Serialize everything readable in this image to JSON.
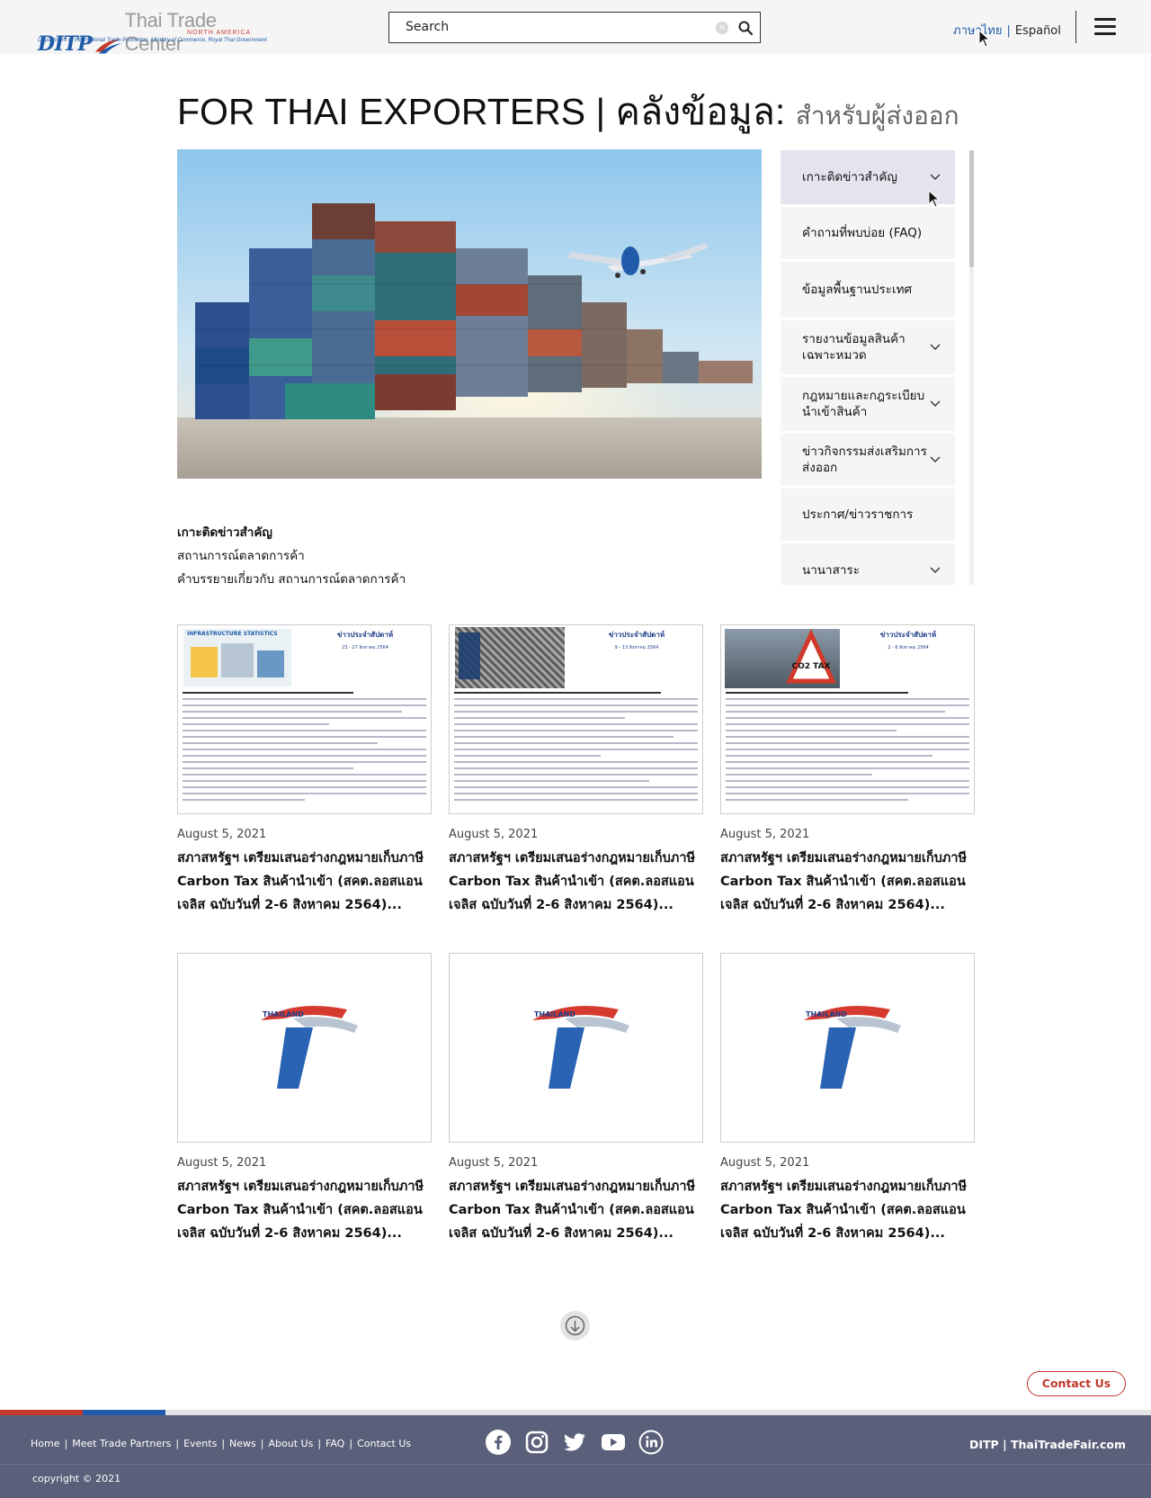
{
  "header": {
    "logo": {
      "brand": "DITP",
      "name": "Thai Trade Center",
      "region": "NORTH AMERICA",
      "tagline": "Department of International Trade Promotion, Ministry of Commerce, Royal Thai Government"
    },
    "search": {
      "placeholder": "Search",
      "value": "Search"
    },
    "language": {
      "thai": "ภาษาไทย",
      "separator": "|",
      "spanish": "Español"
    }
  },
  "page": {
    "title": "FOR THAI EXPORTERS | คลังข้อมูล:",
    "subtitle": "สำหรับผู้ส่งออก"
  },
  "sidebar": {
    "items": [
      {
        "label": "เกาะติดข่าวสำคัญ",
        "expandable": true,
        "active": true
      },
      {
        "label": "คำถามที่พบบ่อย (FAQ)",
        "expandable": false,
        "active": false
      },
      {
        "label": "ข้อมูลพื้นฐานประเทศ",
        "expandable": false,
        "active": false
      },
      {
        "label": "รายงานข้อมูลสินค้าเฉพาะหมวด",
        "expandable": true,
        "active": false
      },
      {
        "label": "กฎหมายและกฎระเบียบนำเข้าสินค้า",
        "expandable": true,
        "active": false
      },
      {
        "label": "ข่าวกิจกรรมส่งเสริมการส่งออก",
        "expandable": true,
        "active": false
      },
      {
        "label": "ประกาศ/ข่าวราชการ",
        "expandable": false,
        "active": false
      },
      {
        "label": "นานาสาระ",
        "expandable": true,
        "active": false
      }
    ]
  },
  "section": {
    "heading": "เกาะติดข่าวสำคัญ",
    "category": "สถานการณ์ตลาดการค้า",
    "description": "คำบรรยายเกี่ยวกับ สถานการณ์ตลาดการค้า"
  },
  "cards": [
    {
      "date": "August 5, 2021",
      "title": "สภาสหรัฐฯ เตรียมเสนอร่างกฎหมายเก็บภาษี Carbon Tax สินค้านำเข้า (สคต.ลอสแอนเจลิส ฉบับวันที่ 2-6 สิงหาคม 2564)...",
      "image": "newsletter-infrastructure",
      "doc_title": "ข่าวประจำสัปดาห์",
      "doc_dates": "23 - 27 สิงหาคม 2564",
      "doc_badge": "INFRASTRUCTURE STATISTICS"
    },
    {
      "date": "August 5, 2021",
      "title": "สภาสหรัฐฯ เตรียมเสนอร่างกฎหมายเก็บภาษี Carbon Tax สินค้านำเข้า (สคต.ลอสแอนเจลิส ฉบับวันที่ 2-6 สิงหาคม 2564)...",
      "image": "newsletter-seafood",
      "doc_title": "ข่าวประจำสัปดาห์",
      "doc_dates": "9 - 13 สิงหาคม 2564",
      "doc_badge": ""
    },
    {
      "date": "August 5, 2021",
      "title": "สภาสหรัฐฯ เตรียมเสนอร่างกฎหมายเก็บภาษี Carbon Tax สินค้านำเข้า (สคต.ลอสแอนเจลิส ฉบับวันที่ 2-6 สิงหาคม 2564)...",
      "image": "newsletter-carbon-tax",
      "doc_title": "ข่าวประจำสัปดาห์",
      "doc_dates": "2 - 6 สิงหาคม 2564",
      "doc_badge": "CO2 TAX"
    },
    {
      "date": "August 5, 2021",
      "title": "สภาสหรัฐฯ เตรียมเสนอร่างกฎหมายเก็บภาษี Carbon Tax สินค้านำเข้า (สคต.ลอสแอนเจลิส ฉบับวันที่ 2-6 สิงหาคม 2564)...",
      "image": "thailand-trust-logo",
      "logo_text": "THAILAND"
    },
    {
      "date": "August 5, 2021",
      "title": "สภาสหรัฐฯ เตรียมเสนอร่างกฎหมายเก็บภาษี Carbon Tax สินค้านำเข้า (สคต.ลอสแอนเจลิส ฉบับวันที่ 2-6 สิงหาคม 2564)...",
      "image": "thailand-trust-logo",
      "logo_text": "THAILAND"
    },
    {
      "date": "August 5, 2021",
      "title": "สภาสหรัฐฯ เตรียมเสนอร่างกฎหมายเก็บภาษี Carbon Tax สินค้านำเข้า (สคต.ลอสแอนเจลิส ฉบับวันที่ 2-6 สิงหาคม 2564)...",
      "image": "thailand-trust-logo",
      "logo_text": "THAILAND"
    }
  ],
  "contact_button": "Contact Us",
  "footer": {
    "links": [
      "Home",
      "Meet Trade Partners",
      "Events",
      "News",
      "About Us",
      "FAQ",
      "Contact Us"
    ],
    "social": [
      "facebook-icon",
      "instagram-icon",
      "twitter-icon",
      "youtube-icon",
      "linkedin-icon"
    ],
    "brand": "DITP | ThaiTradeFair.com",
    "copyright": "copyright © 2021"
  },
  "colors": {
    "brand_blue": "#1f5ba8",
    "brand_red": "#c0392b",
    "footer_bg": "#5a6079"
  }
}
